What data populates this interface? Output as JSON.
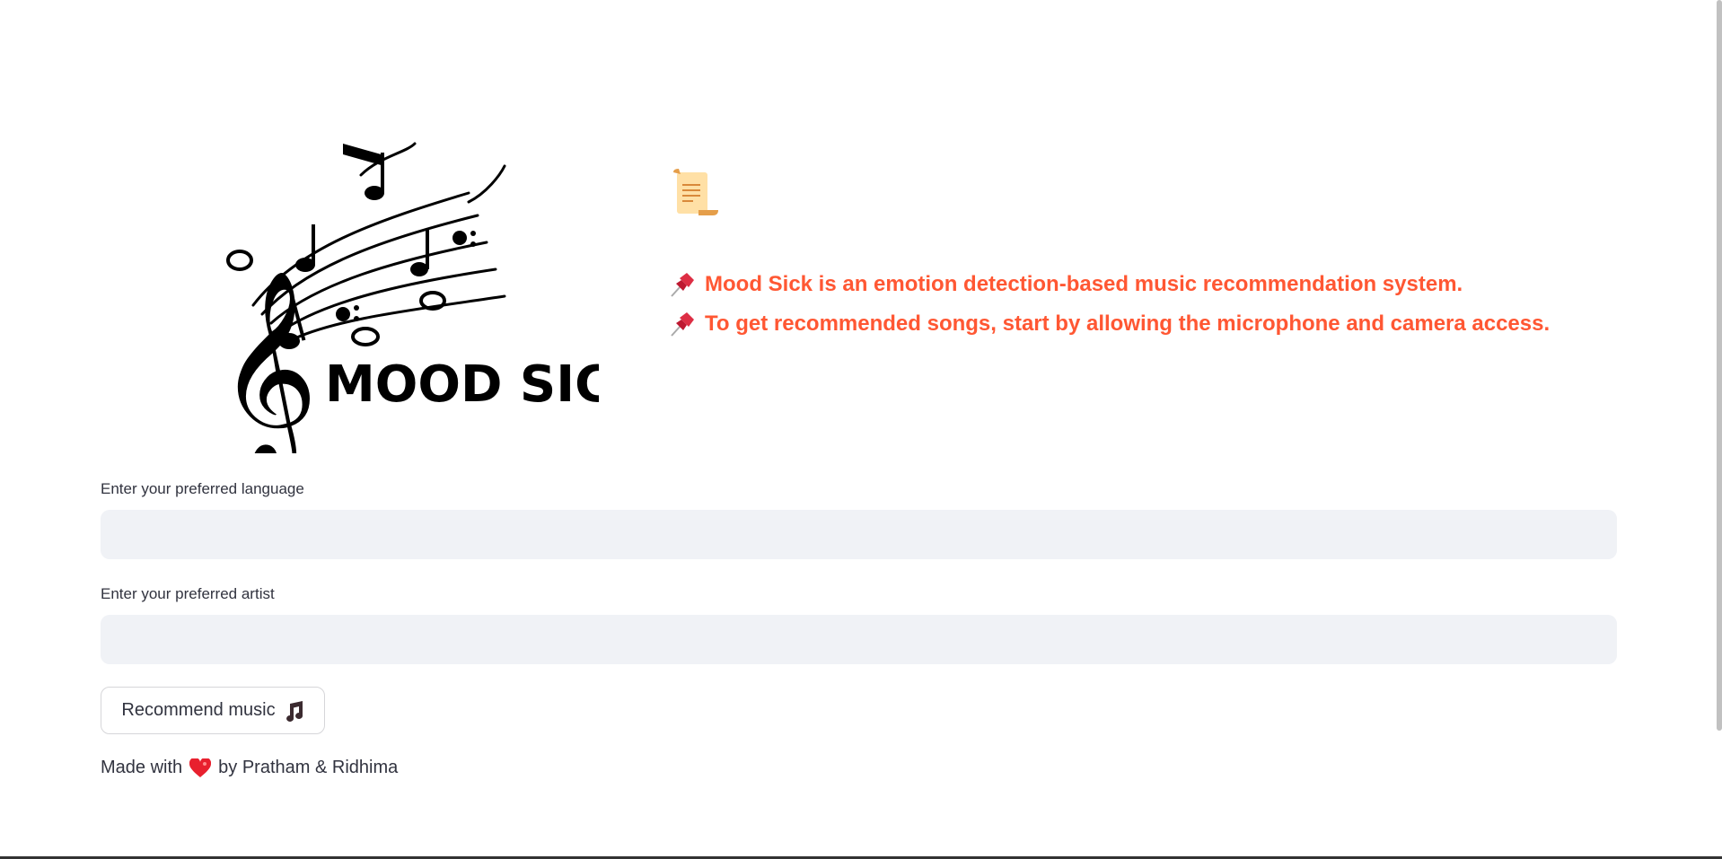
{
  "logo": {
    "text": "MOOD SICK"
  },
  "header": {
    "icon": "scroll-icon",
    "info_lines": [
      {
        "icon": "pushpin-icon",
        "text": "Mood Sick is an emotion detection-based music recommendation system."
      },
      {
        "icon": "pushpin-icon",
        "text": "To get recommended songs, start by allowing the microphone and camera access."
      }
    ],
    "accent_color": "#ff5733"
  },
  "form": {
    "language_label": "Enter your preferred language",
    "language_value": "",
    "artist_label": "Enter your preferred artist",
    "artist_value": "",
    "recommend_label": "Recommend music",
    "recommend_icon": "musical-notes-icon"
  },
  "footer": {
    "prefix": "Made with",
    "icon": "heart-icon",
    "suffix": "by Pratham & Ridhima"
  }
}
